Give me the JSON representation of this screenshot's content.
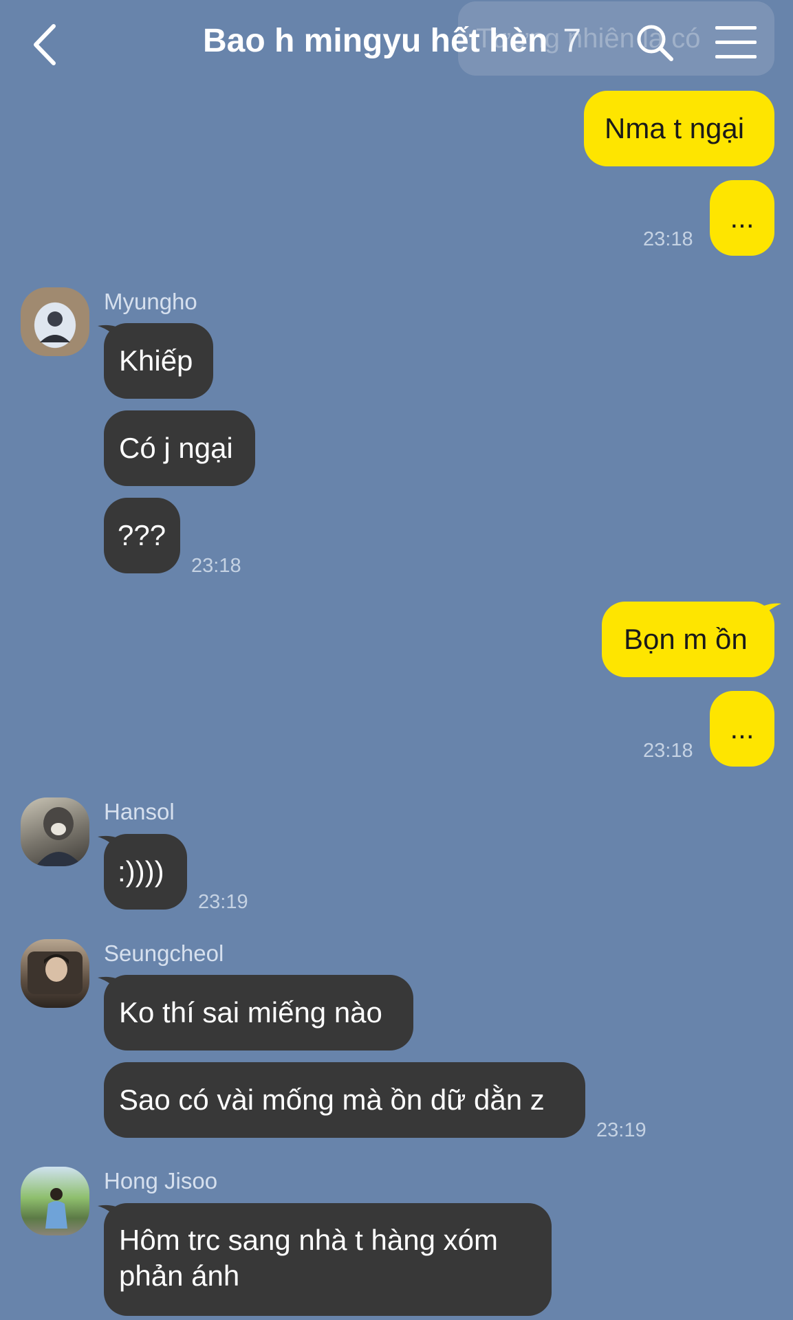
{
  "header": {
    "title": "Bao h mingyu hết hèn",
    "member_count": "7",
    "notice_text": "Tương nhiên là có"
  },
  "messages": {
    "m1": "Nma t ngại",
    "m2": "...",
    "t1": "23:18",
    "sender_myungho": "Myungho",
    "m3": "Khiếp",
    "m4": "Có j ngại",
    "m5": "???",
    "t2": "23:18",
    "m6": "Bọn m ồn",
    "m7": "...",
    "t3": "23:18",
    "sender_hansol": "Hansol",
    "m8": ":))))",
    "t4": "23:19",
    "sender_seungcheol": "Seungcheol",
    "m9": "Ko thí sai miếng nào",
    "m10": "Sao có vài mống mà ồn dữ dằn z",
    "t5": "23:19",
    "sender_jisoo": "Hong Jisoo",
    "m11": "Hôm trc sang nhà t hàng xóm phản ánh"
  },
  "colors": {
    "background": "#6884ab",
    "my_bubble": "#fee500",
    "other_bubble": "#383838"
  }
}
